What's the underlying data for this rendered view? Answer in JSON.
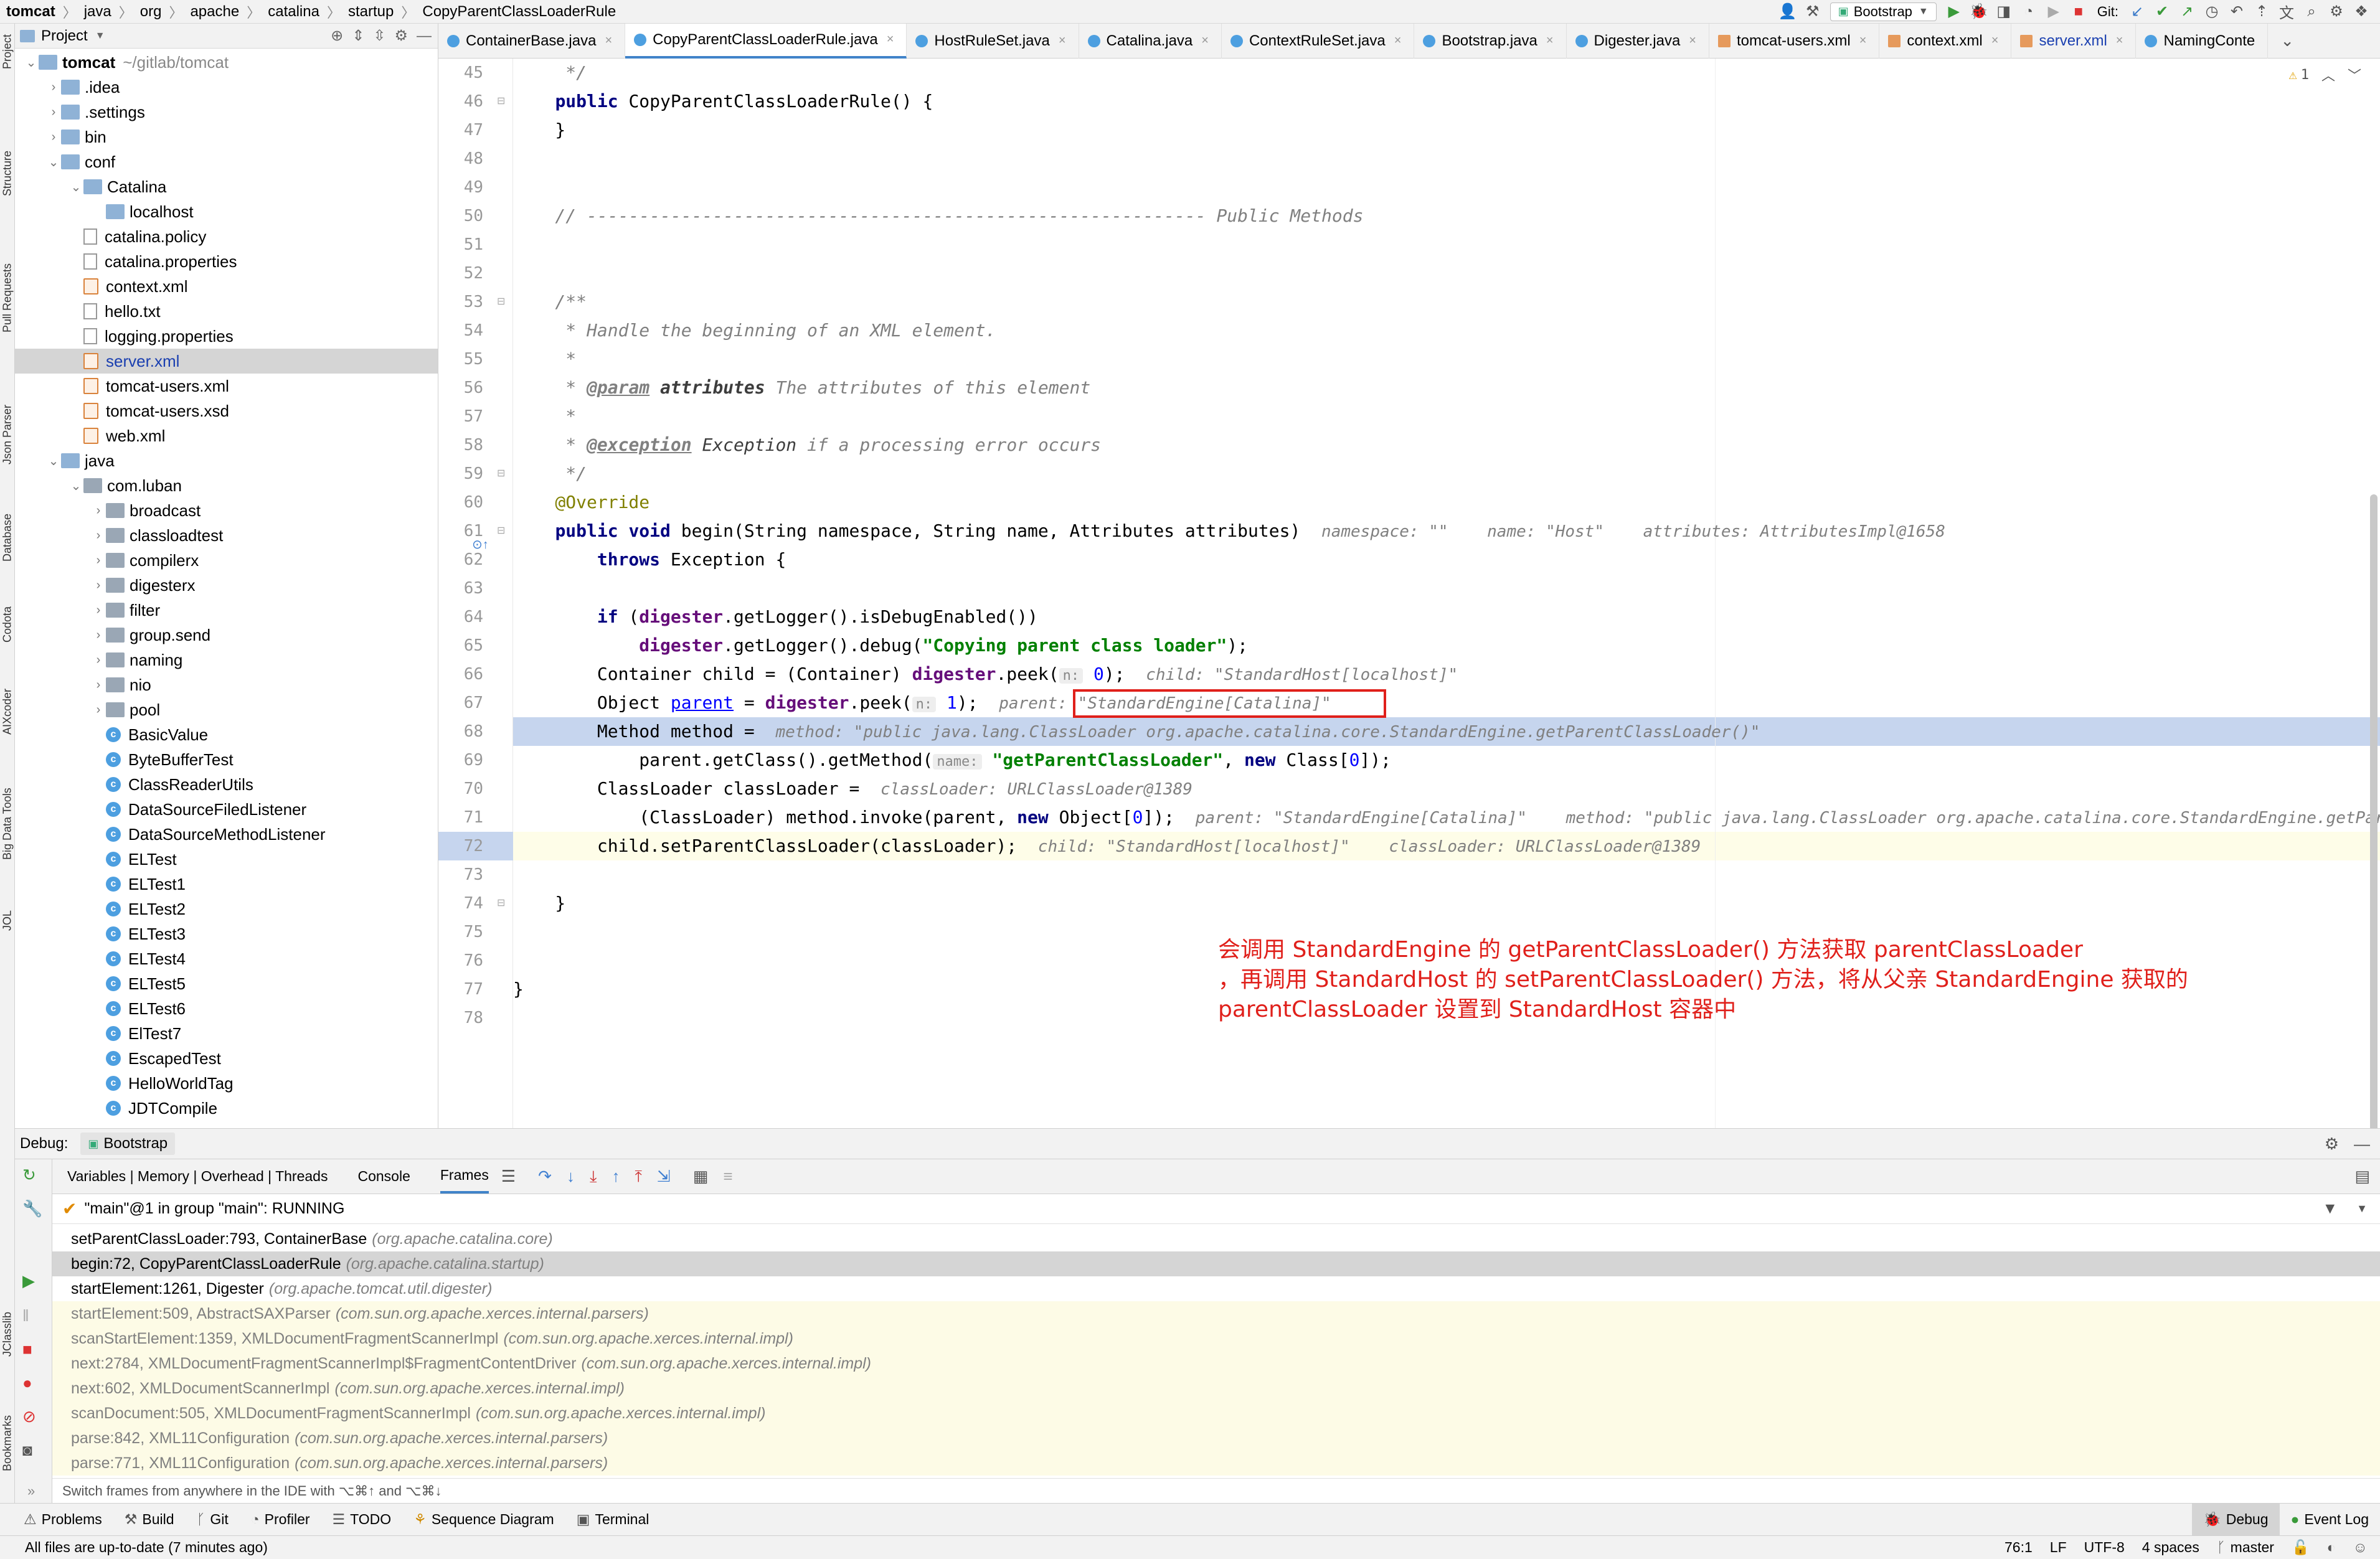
{
  "breadcrumb": [
    "tomcat",
    "java",
    "org",
    "apache",
    "catalina",
    "startup",
    "CopyParentClassLoaderRule"
  ],
  "run_config": "Bootstrap",
  "git_label": "Git:",
  "left_strip": [
    "Project",
    "Structure",
    "Pull Requests",
    "Json Parser",
    "Database",
    "Codota",
    "AIXcoder",
    "Big Data Tools",
    "JOL",
    "JClasslib",
    "Bookmarks"
  ],
  "project_panel": {
    "title": "Project",
    "rows": [
      {
        "label": "tomcat",
        "extra": "~/gitlab/tomcat",
        "indent": 0,
        "arrow": "open",
        "icon": "folder"
      },
      {
        "label": ".idea",
        "indent": 1,
        "arrow": "closed",
        "icon": "folder"
      },
      {
        "label": ".settings",
        "indent": 1,
        "arrow": "closed",
        "icon": "folder"
      },
      {
        "label": "bin",
        "indent": 1,
        "arrow": "closed",
        "icon": "folder"
      },
      {
        "label": "conf",
        "indent": 1,
        "arrow": "open",
        "icon": "folder"
      },
      {
        "label": "Catalina",
        "indent": 2,
        "arrow": "open",
        "icon": "folder"
      },
      {
        "label": "localhost",
        "indent": 3,
        "arrow": "none",
        "icon": "folder"
      },
      {
        "label": "catalina.policy",
        "indent": 2,
        "arrow": "none",
        "icon": "file"
      },
      {
        "label": "catalina.properties",
        "indent": 2,
        "arrow": "none",
        "icon": "file"
      },
      {
        "label": "context.xml",
        "indent": 2,
        "arrow": "none",
        "icon": "xml"
      },
      {
        "label": "hello.txt",
        "indent": 2,
        "arrow": "none",
        "icon": "file"
      },
      {
        "label": "logging.properties",
        "indent": 2,
        "arrow": "none",
        "icon": "file"
      },
      {
        "label": "server.xml",
        "indent": 2,
        "arrow": "none",
        "icon": "xml",
        "selected": true
      },
      {
        "label": "tomcat-users.xml",
        "indent": 2,
        "arrow": "none",
        "icon": "xml"
      },
      {
        "label": "tomcat-users.xsd",
        "indent": 2,
        "arrow": "none",
        "icon": "xml"
      },
      {
        "label": "web.xml",
        "indent": 2,
        "arrow": "none",
        "icon": "xml"
      },
      {
        "label": "java",
        "indent": 1,
        "arrow": "open",
        "icon": "folder"
      },
      {
        "label": "com.luban",
        "indent": 2,
        "arrow": "open",
        "icon": "pkg"
      },
      {
        "label": "broadcast",
        "indent": 3,
        "arrow": "closed",
        "icon": "pkg"
      },
      {
        "label": "classloadtest",
        "indent": 3,
        "arrow": "closed",
        "icon": "pkg"
      },
      {
        "label": "compilerx",
        "indent": 3,
        "arrow": "closed",
        "icon": "pkg"
      },
      {
        "label": "digesterx",
        "indent": 3,
        "arrow": "closed",
        "icon": "pkg"
      },
      {
        "label": "filter",
        "indent": 3,
        "arrow": "closed",
        "icon": "pkg"
      },
      {
        "label": "group.send",
        "indent": 3,
        "arrow": "closed",
        "icon": "pkg"
      },
      {
        "label": "naming",
        "indent": 3,
        "arrow": "closed",
        "icon": "pkg"
      },
      {
        "label": "nio",
        "indent": 3,
        "arrow": "closed",
        "icon": "pkg"
      },
      {
        "label": "pool",
        "indent": 3,
        "arrow": "closed",
        "icon": "pkg"
      },
      {
        "label": "BasicValue",
        "indent": 3,
        "arrow": "none",
        "icon": "class"
      },
      {
        "label": "ByteBufferTest",
        "indent": 3,
        "arrow": "none",
        "icon": "class"
      },
      {
        "label": "ClassReaderUtils",
        "indent": 3,
        "arrow": "none",
        "icon": "class"
      },
      {
        "label": "DataSourceFiledListener",
        "indent": 3,
        "arrow": "none",
        "icon": "class"
      },
      {
        "label": "DataSourceMethodListener",
        "indent": 3,
        "arrow": "none",
        "icon": "class"
      },
      {
        "label": "ELTest",
        "indent": 3,
        "arrow": "none",
        "icon": "class"
      },
      {
        "label": "ELTest1",
        "indent": 3,
        "arrow": "none",
        "icon": "class"
      },
      {
        "label": "ELTest2",
        "indent": 3,
        "arrow": "none",
        "icon": "class"
      },
      {
        "label": "ELTest3",
        "indent": 3,
        "arrow": "none",
        "icon": "class"
      },
      {
        "label": "ELTest4",
        "indent": 3,
        "arrow": "none",
        "icon": "class"
      },
      {
        "label": "ELTest5",
        "indent": 3,
        "arrow": "none",
        "icon": "class"
      },
      {
        "label": "ELTest6",
        "indent": 3,
        "arrow": "none",
        "icon": "class"
      },
      {
        "label": "ElTest7",
        "indent": 3,
        "arrow": "none",
        "icon": "class"
      },
      {
        "label": "EscapedTest",
        "indent": 3,
        "arrow": "none",
        "icon": "class"
      },
      {
        "label": "HelloWorldTag",
        "indent": 3,
        "arrow": "none",
        "icon": "class"
      },
      {
        "label": "JDTCompile",
        "indent": 3,
        "arrow": "none",
        "icon": "class"
      }
    ]
  },
  "tabs": [
    {
      "label": "ContainerBase.java",
      "icon": "class"
    },
    {
      "label": "CopyParentClassLoaderRule.java",
      "icon": "class",
      "active": true
    },
    {
      "label": "HostRuleSet.java",
      "icon": "class"
    },
    {
      "label": "Catalina.java",
      "icon": "class"
    },
    {
      "label": "ContextRuleSet.java",
      "icon": "class"
    },
    {
      "label": "Bootstrap.java",
      "icon": "class"
    },
    {
      "label": "Digester.java",
      "icon": "class"
    },
    {
      "label": "tomcat-users.xml",
      "icon": "xml"
    },
    {
      "label": "context.xml",
      "icon": "xml"
    },
    {
      "label": "server.xml",
      "icon": "xml"
    },
    {
      "label": "NamingConte",
      "icon": "class"
    }
  ],
  "warning_count": "1",
  "line_numbers": [
    "45",
    "46",
    "47",
    "48",
    "49",
    "50",
    "51",
    "52",
    "53",
    "54",
    "55",
    "56",
    "57",
    "58",
    "59",
    "60",
    "61",
    "62",
    "63",
    "64",
    "65",
    "66",
    "67",
    "68",
    "69",
    "70",
    "71",
    "72",
    "73",
    "74",
    "75",
    "76",
    "77",
    "78"
  ],
  "code": {
    "l45": "     */",
    "l46_kw": "public",
    "l46_rest": " CopyParentClassLoaderRule() {",
    "l47": "    }",
    "l50": "    // ----------------------------------------------------------- Public Methods",
    "l53": "    /**",
    "l54": "     * Handle the beginning of an XML element.",
    "l55": "     *",
    "l56_a": "     * ",
    "l56_tag": "@param",
    "l56_name": " attributes",
    "l56_rest": " The attributes of this element",
    "l57": "     *",
    "l58_a": "     * ",
    "l58_tag": "@exception",
    "l58_name": " Exception",
    "l58_rest": " if a processing error occurs",
    "l59": "     */",
    "l60": "    @Override",
    "l61_kw": "public void",
    "l61_rest": " begin(String namespace, String name, Attributes attributes)",
    "l61_hint": "namespace: \"\"    name: \"Host\"    attributes: AttributesImpl@1658",
    "l62_kw": "throws",
    "l62_rest": " Exception {",
    "l64_kw": "if",
    "l64_a": " (",
    "l64_fld": "digester",
    "l64_rest": ".getLogger().isDebugEnabled())",
    "l65_fld": "digester",
    "l65_a": ".getLogger().debug(",
    "l65_str": "\"Copying parent class loader\"",
    "l65_rest": ");",
    "l66_a": "Container child = (Container) ",
    "l66_fld": "digester",
    "l66_b": ".peek(",
    "l66_ph": "n:",
    "l66_num": " 0",
    "l66_c": ");",
    "l66_hint": "child: \"StandardHost[localhost]\"",
    "l67_a": "Object ",
    "l67_lnk": "parent",
    "l67_b": " = ",
    "l67_fld": "digester",
    "l67_c": ".peek(",
    "l67_ph": "n:",
    "l67_num": " 1",
    "l67_d": ");",
    "l67_hint1": "parent:",
    "l67_hint2": "\"StandardEngine[Catalina]\"",
    "l68_a": "Method method =",
    "l68_hint": "method: \"public java.lang.ClassLoader org.apache.catalina.core.StandardEngine.getParentClassLoader()\"",
    "l69_a": "parent.getClass().getMethod(",
    "l69_ph": "name:",
    "l69_str": " \"getParentClassLoader\"",
    "l69_b": ", ",
    "l69_kw": "new",
    "l69_c": " Class[",
    "l69_num": "0",
    "l69_d": "]);",
    "l70_a": "ClassLoader classLoader =",
    "l70_hint": "classLoader: URLClassLoader@1389",
    "l71_a": "(ClassLoader) method.invoke(parent, ",
    "l71_kw": "new",
    "l71_b": " Object[",
    "l71_num": "0",
    "l71_c": "]);",
    "l71_hint": "parent: \"StandardEngine[Catalina]\"    method: \"public java.lang.ClassLoader org.apache.catalina.core.StandardEngine.getPar",
    "l72_a": "child.setParentClassLoader(classLoader);",
    "l72_hint": "child: \"StandardHost[localhost]\"    classLoader: URLClassLoader@1389",
    "l74": "    }",
    "l77": "}"
  },
  "annotation_note": {
    "line1": "会调用 StandardEngine 的 getParentClassLoader() 方法获取 parentClassLoader",
    "line2": "，再调用 StandardHost 的 setParentClassLoader() 方法，将从父亲 StandardEngine 获取的",
    "line3": "parentClassLoader 设置到 StandardHost 容器中",
    "color": "#e0201b"
  },
  "debug": {
    "title": "Debug:",
    "config": "Bootstrap",
    "toolbar_tabs": [
      "Variables | Memory | Overhead | Threads",
      "Console",
      "Frames"
    ],
    "thread": "\"main\"@1 in group \"main\": RUNNING",
    "frames": [
      {
        "method": "setParentClassLoader:793, ContainerBase",
        "pkg": "(org.apache.catalina.core)",
        "lib": false
      },
      {
        "method": "begin:72, CopyParentClassLoaderRule",
        "pkg": "(org.apache.catalina.startup)",
        "lib": false,
        "selected": true
      },
      {
        "method": "startElement:1261, Digester",
        "pkg": "(org.apache.tomcat.util.digester)",
        "lib": false
      },
      {
        "method": "startElement:509, AbstractSAXParser",
        "pkg": "(com.sun.org.apache.xerces.internal.parsers)",
        "lib": true
      },
      {
        "method": "scanStartElement:1359, XMLDocumentFragmentScannerImpl",
        "pkg": "(com.sun.org.apache.xerces.internal.impl)",
        "lib": true
      },
      {
        "method": "next:2784, XMLDocumentFragmentScannerImpl$FragmentContentDriver",
        "pkg": "(com.sun.org.apache.xerces.internal.impl)",
        "lib": true
      },
      {
        "method": "next:602, XMLDocumentScannerImpl",
        "pkg": "(com.sun.org.apache.xerces.internal.impl)",
        "lib": true
      },
      {
        "method": "scanDocument:505, XMLDocumentFragmentScannerImpl",
        "pkg": "(com.sun.org.apache.xerces.internal.impl)",
        "lib": true
      },
      {
        "method": "parse:842, XML11Configuration",
        "pkg": "(com.sun.org.apache.xerces.internal.parsers)",
        "lib": true
      },
      {
        "method": "parse:771, XML11Configuration",
        "pkg": "(com.sun.org.apache.xerces.internal.parsers)",
        "lib": true
      }
    ],
    "hint_bar": "Switch frames from anywhere in the IDE with ⌥⌘↑ and ⌥⌘↓"
  },
  "bottom_tabs": [
    "Problems",
    "Build",
    "Git",
    "Profiler",
    "TODO",
    "Sequence Diagram",
    "Terminal"
  ],
  "bottom_right_tabs": [
    "Debug",
    "Event Log"
  ],
  "status": {
    "message": "All files are up-to-date (7 minutes ago)",
    "position": "76:1",
    "line_sep": "LF",
    "encoding": "UTF-8",
    "indent": "4 spaces",
    "branch": "master"
  },
  "colors": {
    "accent": "#4083c9",
    "highlight_box": "#e0201b",
    "exec_line": "#c6d5ee"
  }
}
